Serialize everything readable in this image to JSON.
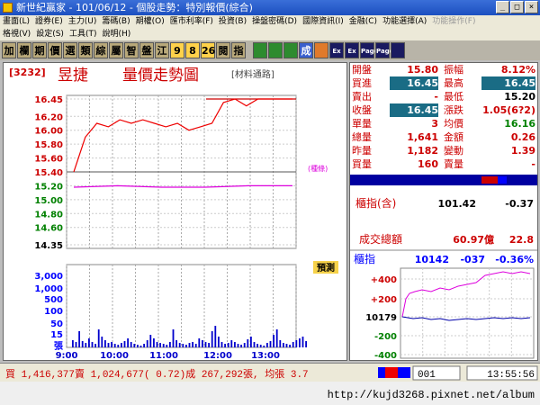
{
  "window": {
    "title": "新世紀贏家 - 101/06/12 - 個股走勢：特別報價(綜合)",
    "buttons": [
      "_",
      "□",
      "×"
    ]
  },
  "menu": {
    "row1": [
      {
        "label": "畫面(L)"
      },
      {
        "label": "證券(E)"
      },
      {
        "label": "主力(U)"
      },
      {
        "label": "籌碼(B)"
      },
      {
        "label": "期權(O)"
      },
      {
        "label": "匯市利率(F)"
      },
      {
        "label": "投資(B)"
      },
      {
        "label": "操盤密碼(D)"
      },
      {
        "label": "國際資訊(I)"
      },
      {
        "label": "金融(C)"
      },
      {
        "label": "功能選擇(A)"
      },
      {
        "label": "功能操作(F)",
        "disabled": true
      }
    ],
    "row2": [
      {
        "label": "格視(V)"
      },
      {
        "label": "設定(S)"
      },
      {
        "label": "工具(T)"
      },
      {
        "label": "說明(H)"
      }
    ]
  },
  "toolbar": {
    "buttons": [
      {
        "label": "加",
        "style": "g"
      },
      {
        "label": "欄",
        "style": "g"
      },
      {
        "label": "期",
        "style": "g"
      },
      {
        "label": "價",
        "style": "g"
      },
      {
        "label": "選",
        "style": "g"
      },
      {
        "label": "類",
        "style": "g"
      },
      {
        "label": "綜",
        "style": "g"
      },
      {
        "label": "屬",
        "style": "g"
      },
      {
        "label": "智",
        "style": "g"
      },
      {
        "label": "盤",
        "style": "g"
      },
      {
        "label": "江",
        "style": "g"
      },
      {
        "label": "9",
        "style": "y"
      },
      {
        "label": "8",
        "style": "y"
      },
      {
        "label": "26",
        "style": "y"
      },
      {
        "label": "閱",
        "style": "g"
      },
      {
        "label": "指",
        "style": "g"
      },
      {
        "label": "",
        "style": "sep"
      },
      {
        "label": "",
        "style": "gr"
      },
      {
        "label": "",
        "style": "gr"
      },
      {
        "label": "",
        "style": "gr"
      },
      {
        "label": "成",
        "style": "b"
      },
      {
        "label": "",
        "style": "o"
      },
      {
        "label": "Ex",
        "style": "n"
      },
      {
        "label": "Ex",
        "style": "n"
      },
      {
        "label": "Page",
        "style": "n"
      },
      {
        "label": "Page",
        "style": "n"
      },
      {
        "label": "",
        "style": "n"
      }
    ]
  },
  "chart": {
    "code": "[3232]",
    "name": "昱捷",
    "title": "量價走勢圖",
    "material": "[材料通路]",
    "price_axis": [
      "16.45",
      "16.20",
      "16.00",
      "15.80",
      "15.60",
      "15.40",
      "15.20",
      "15.00",
      "14.80",
      "14.60",
      "14.35"
    ],
    "volume_axis": [
      "3,000",
      "1,000",
      "500",
      "100",
      "50",
      "15",
      "張"
    ],
    "time_axis": [
      "9:00",
      "10:00",
      "11:00",
      "12:00",
      "13:00"
    ],
    "price_tag": "(種條)",
    "badge": "預測"
  },
  "chart_data": {
    "type": "line",
    "series": [
      {
        "name": "price",
        "x": [
          "9:00",
          "9:10",
          "9:20",
          "9:30",
          "9:40",
          "9:50",
          "10:00",
          "10:15",
          "10:30",
          "10:45",
          "11:00",
          "11:15",
          "11:30",
          "11:45",
          "12:00",
          "12:15",
          "12:30",
          "12:45",
          "13:00",
          "13:30"
        ],
        "values": [
          15.4,
          15.9,
          16.1,
          16.05,
          16.15,
          16.1,
          16.15,
          16.1,
          16.05,
          16.1,
          16.0,
          16.05,
          16.1,
          16.4,
          16.45,
          16.35,
          16.45,
          16.45,
          16.45,
          16.45
        ]
      },
      {
        "name": "average",
        "x": [
          "9:00",
          "10:00",
          "11:00",
          "12:00",
          "13:00",
          "13:30"
        ],
        "values": [
          15.18,
          15.2,
          15.18,
          15.18,
          15.2,
          15.2
        ]
      }
    ],
    "ylim": [
      14.35,
      16.45
    ]
  },
  "quote": {
    "rows": [
      {
        "l1": "開盤",
        "v1": "15.80",
        "l2": "振幅",
        "v2": "8.12%",
        "v1s": "r",
        "v2s": "r"
      },
      {
        "l1": "買進",
        "v1": "16.45",
        "l2": "最高",
        "v2": "16.45",
        "v1s": "box",
        "v2s": "box"
      },
      {
        "l1": "賣出",
        "v1": "-",
        "l2": "最低",
        "v2": "15.20",
        "v1s": "r",
        "v2s": ""
      },
      {
        "l1": "收盤",
        "v1": "16.45",
        "l2": "漲跌",
        "v2": "1.05(6?2)",
        "v1s": "box",
        "v2s": "r"
      },
      {
        "l1": "單量",
        "v1": "3",
        "l2": "均價",
        "v2": "16.16",
        "v1s": "r",
        "v2s": "g"
      },
      {
        "l1": "總量",
        "v1": "1,641",
        "l2": "金額",
        "v2": "0.26",
        "v1s": "r",
        "v2s": "r"
      },
      {
        "l1": "昨量",
        "v1": "1,182",
        "l2": "變動",
        "v2": "1.39",
        "v1s": "r",
        "v2s": "r"
      },
      {
        "l1": "買量",
        "v1": "160",
        "l2": "賣量",
        "v2": "-",
        "v1s": "r",
        "v2s": "r"
      }
    ],
    "index_label": "櫃指(含)",
    "index_value": "101.42",
    "index_change": "-0.37",
    "turnover_label": "成交總額",
    "turnover_value": "60.97億",
    "turnover_change": "22.8"
  },
  "mini": {
    "label": "櫃指",
    "value": "10142",
    "change": "-037",
    "pct": "-0.36%",
    "axis": [
      "+400",
      "+200",
      "10179",
      "-200",
      "-400"
    ]
  },
  "status": {
    "text": "買 1,416,377賣 1,024,677( 0.72)成 267,292張, 均張 3.7",
    "code": "001",
    "time": "13:55:56"
  },
  "footer": {
    "url": "http://kujd3268.pixnet.net/album"
  }
}
